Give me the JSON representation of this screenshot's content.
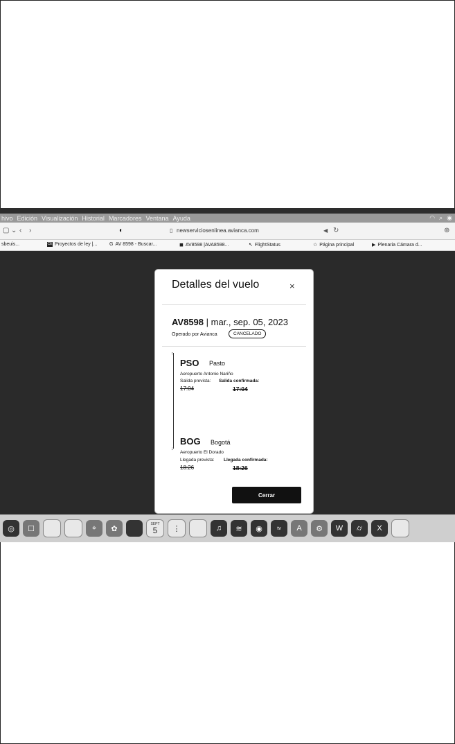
{
  "menubar": {
    "items": [
      "hivo",
      "Edición",
      "Visualización",
      "Historial",
      "Marcadores",
      "Ventana",
      "Ayuda"
    ]
  },
  "browser": {
    "url": "newserviciosenlinea.avianca.com",
    "bookmarks": [
      {
        "label": "sbeuis...",
        "icon": ""
      },
      {
        "label": "Proyectos de ley |...",
        "icon": "CE"
      },
      {
        "label": "AV 8598 - Buscar...",
        "icon": "G"
      },
      {
        "label": "AV8598 |AVA8598...",
        "icon": "◼"
      },
      {
        "label": "FlightStatus",
        "icon": "↖"
      },
      {
        "label": "Página principal",
        "icon": "☆"
      },
      {
        "label": "Plenaria Cámara d...",
        "icon": "▶"
      }
    ]
  },
  "modal": {
    "title": "Detalles del vuelo",
    "close_glyph": "×",
    "flight_code": "AV8598",
    "flight_sep": " | ",
    "flight_date": "mar., sep. 05, 2023",
    "operated_by": "Operado por Avianca",
    "status": "CANCELADO",
    "departure": {
      "code": "PSO",
      "city": "Pasto",
      "airport": "Aeropuerto Antonio Nariño",
      "scheduled_label": "Salida prevista:",
      "confirmed_label": "Salida confirmada:",
      "scheduled_time": "17:04",
      "confirmed_time": "17:04"
    },
    "arrival": {
      "code": "BOG",
      "city": "Bogotá",
      "airport": "Aeropuerto El Dorado",
      "scheduled_label": "Llegada prevista:",
      "confirmed_label": "Llegada confirmada:",
      "scheduled_time": "18:26",
      "confirmed_time": "18:26"
    },
    "close_button": "Cerrar"
  },
  "dock": {
    "calendar_day": "5",
    "calendar_month": "SEPT"
  }
}
